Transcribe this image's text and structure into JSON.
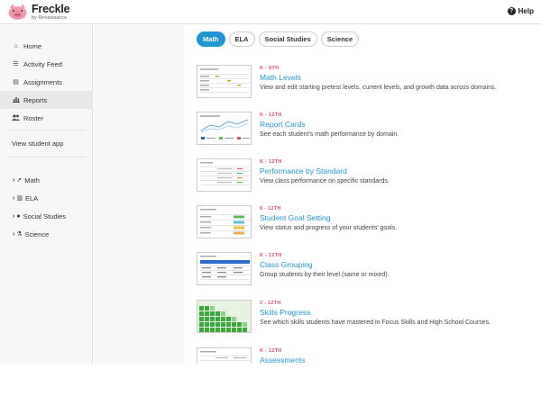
{
  "header": {
    "logo_name": "Freckle",
    "logo_sub": "by Renaissance",
    "help_label": "Help",
    "help_icon": "question-circle-icon"
  },
  "sidebar": {
    "items": [
      {
        "label": "Home",
        "icon": "home-icon"
      },
      {
        "label": "Activity Feed",
        "icon": "list-icon"
      },
      {
        "label": "Assignments",
        "icon": "briefcase-icon"
      },
      {
        "label": "Reports",
        "icon": "bar-chart-icon",
        "active": true
      },
      {
        "label": "Roster",
        "icon": "users-icon"
      }
    ],
    "student_app_label": "View student app",
    "subjects": [
      {
        "label": "Math",
        "icon": "rocket-icon"
      },
      {
        "label": "ELA",
        "icon": "book-icon"
      },
      {
        "label": "Social Studies",
        "icon": "globe-icon"
      },
      {
        "label": "Science",
        "icon": "flask-icon"
      }
    ]
  },
  "tabs": [
    {
      "label": "Math",
      "active": true
    },
    {
      "label": "ELA",
      "active": false
    },
    {
      "label": "Social Studies",
      "active": false
    },
    {
      "label": "Science",
      "active": false
    }
  ],
  "reports": [
    {
      "grade": "K - 8TH",
      "title": "Math Levels",
      "desc": "View and edit starting pretest levels, current levels, and growth data across domains."
    },
    {
      "grade": "K - 12TH",
      "title": "Report Cards",
      "desc": "See each student's math performance by domain."
    },
    {
      "grade": "K - 12TH",
      "title": "Performance by Standard",
      "desc": "View class performance on specific standards."
    },
    {
      "grade": "6 - 12TH",
      "title": "Student Goal Setting",
      "desc": "View status and progress of your students' goals."
    },
    {
      "grade": "K - 12TH",
      "title": "Class Grouping",
      "desc": "Group students by their level (same or mixed)."
    },
    {
      "grade": "2 - 12TH",
      "title": "Skills Progress",
      "desc": "See which skills students have mastered in Focus Skills and High School Courses."
    },
    {
      "grade": "K - 12TH",
      "title": "Assessments",
      "desc": ""
    }
  ]
}
